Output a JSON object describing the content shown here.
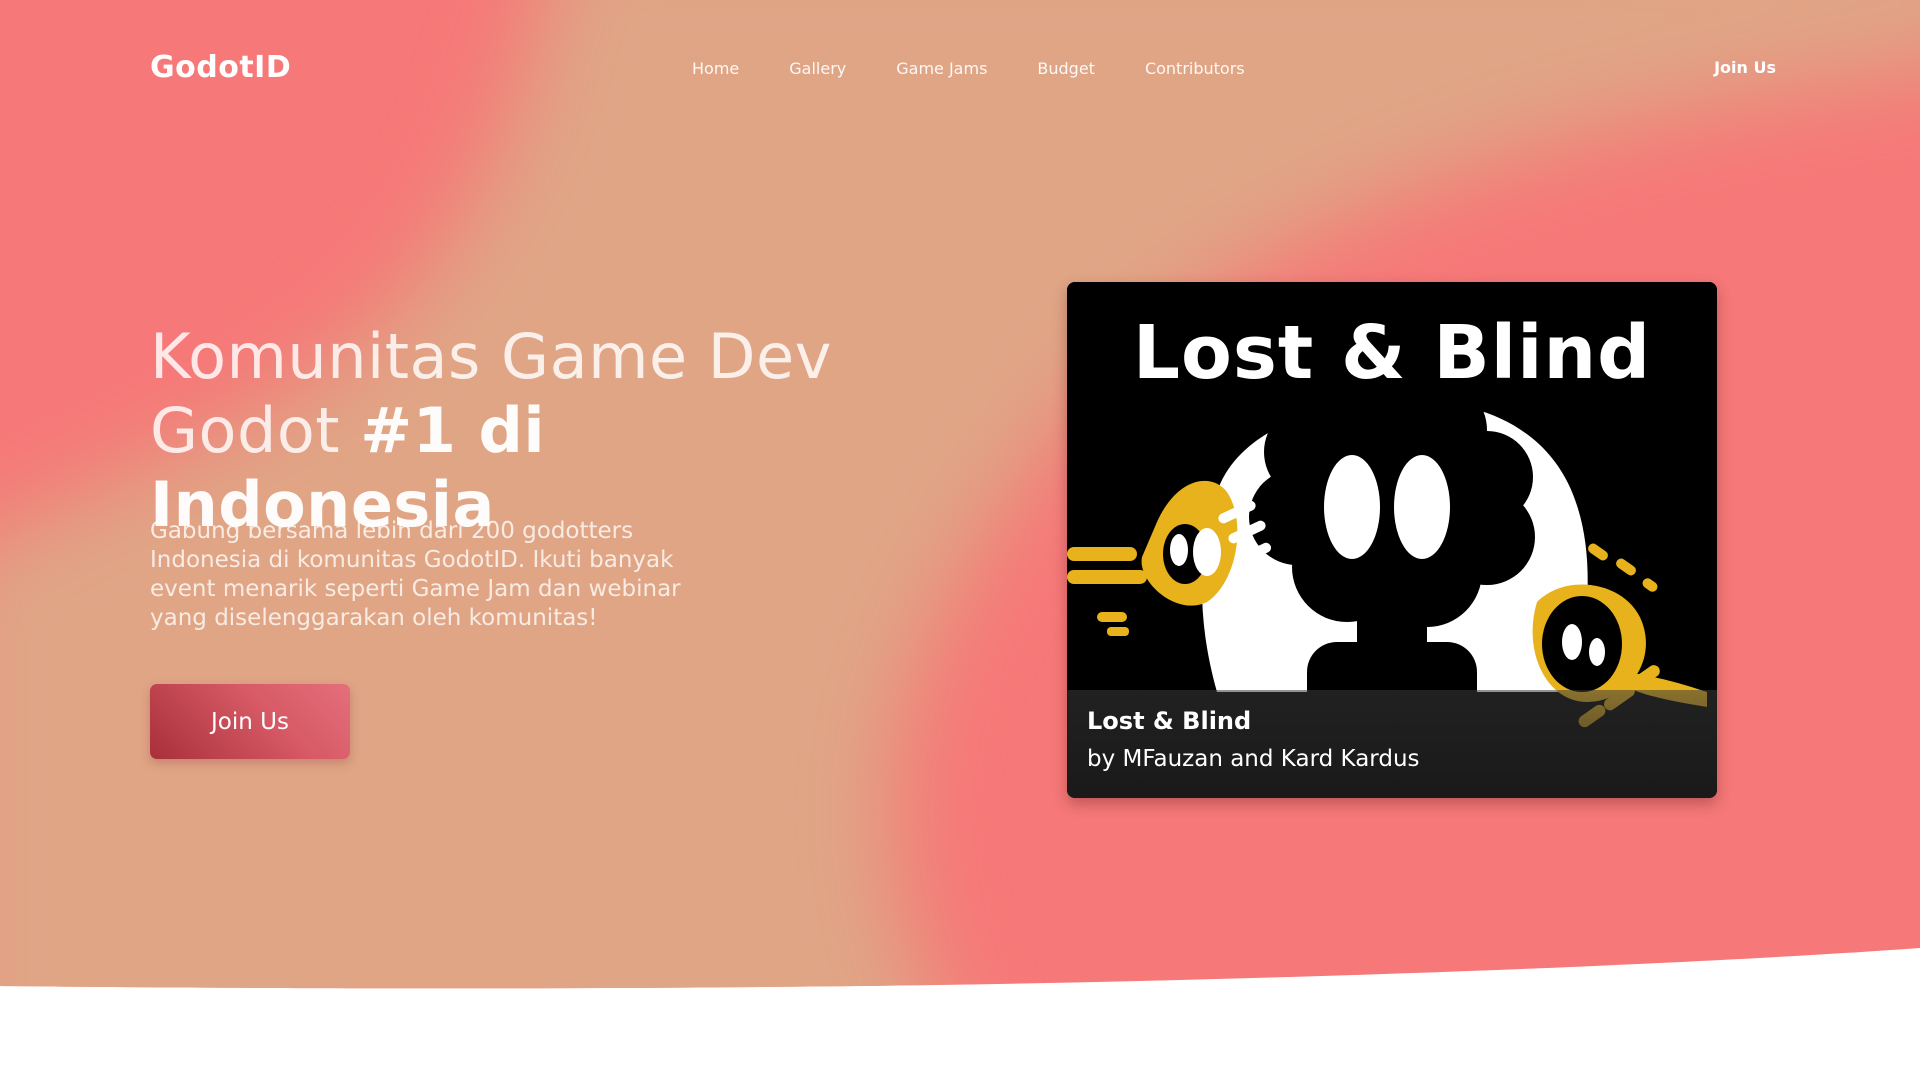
{
  "colors": {
    "coral": "#f67878",
    "peach": "#e0a585",
    "accent": "#c5424f",
    "white": "#ffffff"
  },
  "nav": {
    "brand": "GodotID",
    "links": [
      "Home",
      "Gallery",
      "Game Jams",
      "Budget",
      "Contributors"
    ],
    "cta": "Join Us"
  },
  "hero": {
    "title_light_1": "Komunitas Game Dev",
    "title_light_2": "Godot ",
    "title_strong": "#1 di Indonesia",
    "description": "Gabung bersama lebih dari 200 godotters Indonesia di komunitas GodotID. Ikuti banyak event menarik seperti Game Jam dan webinar yang diselenggarakan oleh komunitas!",
    "button": "Join Us"
  },
  "featured": {
    "logo_text": "Lost & Blind",
    "title": "Lost & Blind",
    "subtitle": "by MFauzan and Kard Kardus"
  },
  "icons": {
    "cover_art": "game-cover-art-icon"
  }
}
